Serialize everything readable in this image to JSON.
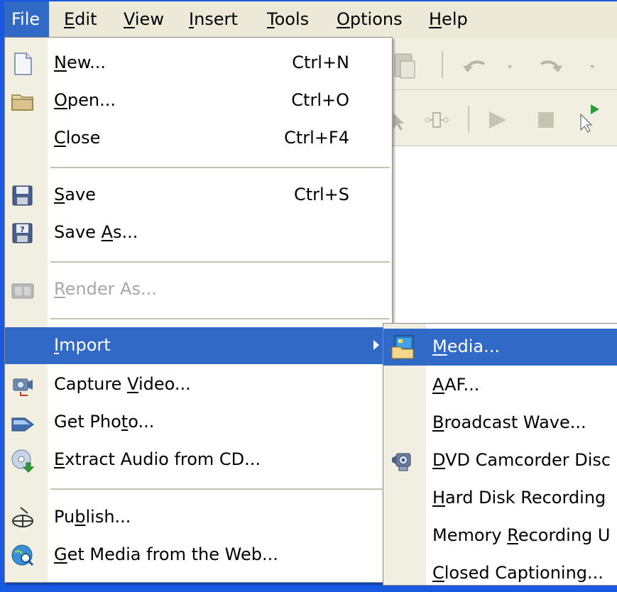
{
  "menubar": {
    "items": [
      {
        "label": "File",
        "active": true
      },
      {
        "label": "Edit",
        "underline": "E",
        "rest": "dit"
      },
      {
        "label": "View",
        "underline": "V",
        "rest": "iew"
      },
      {
        "label": "Insert",
        "underline": "I",
        "rest": "nsert"
      },
      {
        "label": "Tools",
        "underline": "T",
        "rest": "ools"
      },
      {
        "label": "Options",
        "underline": "O",
        "rest": "ptions"
      },
      {
        "label": "Help",
        "underline": "H",
        "rest": "elp"
      }
    ]
  },
  "file_menu": {
    "new": {
      "pre": "",
      "u": "N",
      "post": "ew...",
      "shortcut": "Ctrl+N",
      "icon": "new-document-icon"
    },
    "open": {
      "pre": "",
      "u": "O",
      "post": "pen...",
      "shortcut": "Ctrl+O",
      "icon": "folder-icon"
    },
    "close": {
      "pre": "",
      "u": "C",
      "post": "lose",
      "shortcut": "Ctrl+F4"
    },
    "save": {
      "pre": "",
      "u": "S",
      "post": "ave",
      "shortcut": "Ctrl+S",
      "icon": "floppy-disk-icon"
    },
    "save_as": {
      "pre": "Save ",
      "u": "A",
      "post": "s...",
      "icon": "save-as-icon"
    },
    "render_as": {
      "pre": "",
      "u": "R",
      "post": "ender As...",
      "icon": "render-icon",
      "disabled": true
    },
    "import": {
      "pre": "",
      "u": "I",
      "post": "mport"
    },
    "capture_video": {
      "pre": "Capture ",
      "u": "V",
      "post": "ideo...",
      "icon": "capture-video-icon"
    },
    "get_photo": {
      "pre": "Get Pho",
      "u": "t",
      "post": "o...",
      "icon": "scanner-icon"
    },
    "extract_audio": {
      "pre": "",
      "u": "E",
      "post": "xtract Audio from CD...",
      "icon": "cd-extract-icon"
    },
    "publish": {
      "pre": "Pu",
      "u": "b",
      "post": "lish...",
      "icon": "publish-icon"
    },
    "get_media_web": {
      "pre": "",
      "u": "G",
      "post": "et Media from the Web...",
      "icon": "web-media-icon"
    }
  },
  "import_submenu": {
    "media": {
      "pre": "",
      "u": "M",
      "post": "edia...",
      "icon": "media-import-icon"
    },
    "aaf": {
      "pre": "",
      "u": "A",
      "post": "AF..."
    },
    "broadcast_wave": {
      "pre": "",
      "u": "B",
      "post": "roadcast Wave..."
    },
    "dvd_camcorder": {
      "pre": "",
      "u": "D",
      "post": "VD Camcorder Disc",
      "icon": "camcorder-icon"
    },
    "hard_disk": {
      "pre": "",
      "u": "H",
      "post": "ard Disk Recording"
    },
    "memory_recording": {
      "pre": "Memory ",
      "u": "R",
      "post": "ecording U"
    },
    "closed_captioning": {
      "pre": "",
      "u": "C",
      "post": "losed Captioning..."
    }
  },
  "colors": {
    "highlight": "#3169c6",
    "menubar": "#ece9d8",
    "gutter": "#f1efe2",
    "title_blue": "#1958e0"
  }
}
